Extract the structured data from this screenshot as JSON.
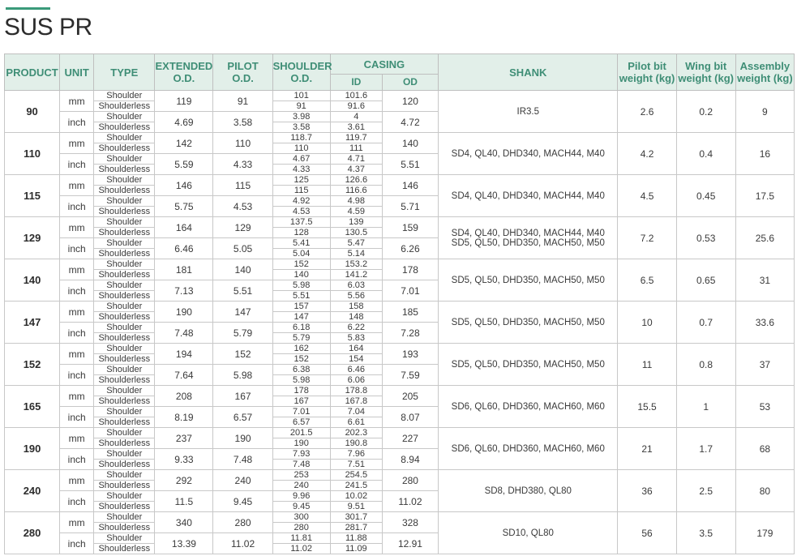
{
  "page": {
    "title": "SUS PR",
    "accent_color": "#3a9a7a",
    "header_bg": "#e2efe9",
    "header_text": "#3f8e76"
  },
  "headers": {
    "product": "PRODUCT",
    "unit": "UNIT",
    "type": "TYPE",
    "extended_1": "EXTENDED",
    "extended_2": "O.D.",
    "pilot_1": "PILOT",
    "pilot_2": "O.D.",
    "shoulder_1": "SHOULDER",
    "shoulder_2": "O.D.",
    "casing": "CASING",
    "casing_id": "ID",
    "casing_od": "OD",
    "shank": "SHANK",
    "pilot_bit_1": "Pilot bit",
    "pilot_bit_2": "weight (kg)",
    "wing_bit_1": "Wing bit",
    "wing_bit_2": "weight (kg)",
    "assembly_1": "Assembly",
    "assembly_2": "weight (kg)"
  },
  "type_labels": {
    "shoulder": "Shoulder",
    "shoulderless": "Shoulderless"
  },
  "products": [
    {
      "product": "90",
      "shank": "IR3.5",
      "pilot_bit": "2.6",
      "wing_bit": "0.2",
      "assembly": "9",
      "mm": {
        "unit": "mm",
        "extended": "119",
        "pilot": "91",
        "shoulder": [
          "101",
          "91"
        ],
        "casing_id": [
          "101.6",
          "91.6"
        ],
        "casing_od": "120"
      },
      "inch": {
        "unit": "inch",
        "extended": "4.69",
        "pilot": "3.58",
        "shoulder": [
          "3.98",
          "3.58"
        ],
        "casing_id": [
          "4",
          "3.61"
        ],
        "casing_od": "4.72"
      }
    },
    {
      "product": "110",
      "shank": "SD4, QL40, DHD340, MACH44, M40",
      "pilot_bit": "4.2",
      "wing_bit": "0.4",
      "assembly": "16",
      "mm": {
        "unit": "mm",
        "extended": "142",
        "pilot": "110",
        "shoulder": [
          "118.7",
          "110"
        ],
        "casing_id": [
          "119.7",
          "111"
        ],
        "casing_od": "140"
      },
      "inch": {
        "unit": "inch",
        "extended": "5.59",
        "pilot": "4.33",
        "shoulder": [
          "4.67",
          "4.33"
        ],
        "casing_id": [
          "4.71",
          "4.37"
        ],
        "casing_od": "5.51"
      }
    },
    {
      "product": "115",
      "shank": "SD4, QL40, DHD340, MACH44, M40",
      "pilot_bit": "4.5",
      "wing_bit": "0.45",
      "assembly": "17.5",
      "mm": {
        "unit": "mm",
        "extended": "146",
        "pilot": "115",
        "shoulder": [
          "125",
          "115"
        ],
        "casing_id": [
          "126.6",
          "116.6"
        ],
        "casing_od": "146"
      },
      "inch": {
        "unit": "inch",
        "extended": "5.75",
        "pilot": "4.53",
        "shoulder": [
          "4.92",
          "4.53"
        ],
        "casing_id": [
          "4.98",
          "4.59"
        ],
        "casing_od": "5.71"
      }
    },
    {
      "product": "129",
      "shank": "SD4, QL40, DHD340, MACH44, M40",
      "shank2": "SD5, QL50, DHD350, MACH50, M50",
      "pilot_bit": "7.2",
      "wing_bit": "0.53",
      "assembly": "25.6",
      "mm": {
        "unit": "mm",
        "extended": "164",
        "pilot": "129",
        "shoulder": [
          "137.5",
          "128"
        ],
        "casing_id": [
          "139",
          "130.5"
        ],
        "casing_od": "159"
      },
      "inch": {
        "unit": "inch",
        "extended": "6.46",
        "pilot": "5.05",
        "shoulder": [
          "5.41",
          "5.04"
        ],
        "casing_id": [
          "5.47",
          "5.14"
        ],
        "casing_od": "6.26"
      }
    },
    {
      "product": "140",
      "shank": "SD5, QL50, DHD350, MACH50, M50",
      "pilot_bit": "6.5",
      "wing_bit": "0.65",
      "assembly": "31",
      "mm": {
        "unit": "mm",
        "extended": "181",
        "pilot": "140",
        "shoulder": [
          "152",
          "140"
        ],
        "casing_id": [
          "153.2",
          "141.2"
        ],
        "casing_od": "178"
      },
      "inch": {
        "unit": "inch",
        "extended": "7.13",
        "pilot": "5.51",
        "shoulder": [
          "5.98",
          "5.51"
        ],
        "casing_id": [
          "6.03",
          "5.56"
        ],
        "casing_od": "7.01"
      }
    },
    {
      "product": "147",
      "shank": "SD5, QL50, DHD350, MACH50, M50",
      "pilot_bit": "10",
      "wing_bit": "0.7",
      "assembly": "33.6",
      "mm": {
        "unit": "mm",
        "extended": "190",
        "pilot": "147",
        "shoulder": [
          "157",
          "147"
        ],
        "casing_id": [
          "158",
          "148"
        ],
        "casing_od": "185"
      },
      "inch": {
        "unit": "inch",
        "extended": "7.48",
        "pilot": "5.79",
        "shoulder": [
          "6.18",
          "5.79"
        ],
        "casing_id": [
          "6.22",
          "5.83"
        ],
        "casing_od": "7.28"
      }
    },
    {
      "product": "152",
      "shank": "SD5, QL50, DHD350, MACH50, M50",
      "pilot_bit": "11",
      "wing_bit": "0.8",
      "assembly": "37",
      "mm": {
        "unit": "mm",
        "extended": "194",
        "pilot": "152",
        "shoulder": [
          "162",
          "152"
        ],
        "casing_id": [
          "164",
          "154"
        ],
        "casing_od": "193"
      },
      "inch": {
        "unit": "inch",
        "extended": "7.64",
        "pilot": "5.98",
        "shoulder": [
          "6.38",
          "5.98"
        ],
        "casing_id": [
          "6.46",
          "6.06"
        ],
        "casing_od": "7.59"
      }
    },
    {
      "product": "165",
      "shank": "SD6, QL60, DHD360, MACH60, M60",
      "pilot_bit": "15.5",
      "wing_bit": "1",
      "assembly": "53",
      "mm": {
        "unit": "mm",
        "extended": "208",
        "pilot": "167",
        "shoulder": [
          "178",
          "167"
        ],
        "casing_id": [
          "178.8",
          "167.8"
        ],
        "casing_od": "205"
      },
      "inch": {
        "unit": "inch",
        "extended": "8.19",
        "pilot": "6.57",
        "shoulder": [
          "7.01",
          "6.57"
        ],
        "casing_id": [
          "7.04",
          "6.61"
        ],
        "casing_od": "8.07"
      }
    },
    {
      "product": "190",
      "shank": "SD6, QL60, DHD360, MACH60, M60",
      "pilot_bit": "21",
      "wing_bit": "1.7",
      "assembly": "68",
      "mm": {
        "unit": "mm",
        "extended": "237",
        "pilot": "190",
        "shoulder": [
          "201.5",
          "190"
        ],
        "casing_id": [
          "202.3",
          "190.8"
        ],
        "casing_od": "227"
      },
      "inch": {
        "unit": "inch",
        "extended": "9.33",
        "pilot": "7.48",
        "shoulder": [
          "7.93",
          "7.48"
        ],
        "casing_id": [
          "7.96",
          "7.51"
        ],
        "casing_od": "8.94"
      }
    },
    {
      "product": "240",
      "shank": "SD8, DHD380, QL80",
      "pilot_bit": "36",
      "wing_bit": "2.5",
      "assembly": "80",
      "mm": {
        "unit": "mm",
        "extended": "292",
        "pilot": "240",
        "shoulder": [
          "253",
          "240"
        ],
        "casing_id": [
          "254.5",
          "241.5"
        ],
        "casing_od": "280"
      },
      "inch": {
        "unit": "inch",
        "extended": "11.5",
        "pilot": "9.45",
        "shoulder": [
          "9.96",
          "9.45"
        ],
        "casing_id": [
          "10.02",
          "9.51"
        ],
        "casing_od": "11.02"
      }
    },
    {
      "product": "280",
      "shank": "SD10, QL80",
      "pilot_bit": "56",
      "wing_bit": "3.5",
      "assembly": "179",
      "mm": {
        "unit": "mm",
        "extended": "340",
        "pilot": "280",
        "shoulder": [
          "300",
          "280"
        ],
        "casing_id": [
          "301.7",
          "281.7"
        ],
        "casing_od": "328"
      },
      "inch": {
        "unit": "inch",
        "extended": "13.39",
        "pilot": "11.02",
        "shoulder": [
          "11.81",
          "11.02"
        ],
        "casing_id": [
          "11.88",
          "11.09"
        ],
        "casing_od": "12.91"
      }
    }
  ]
}
